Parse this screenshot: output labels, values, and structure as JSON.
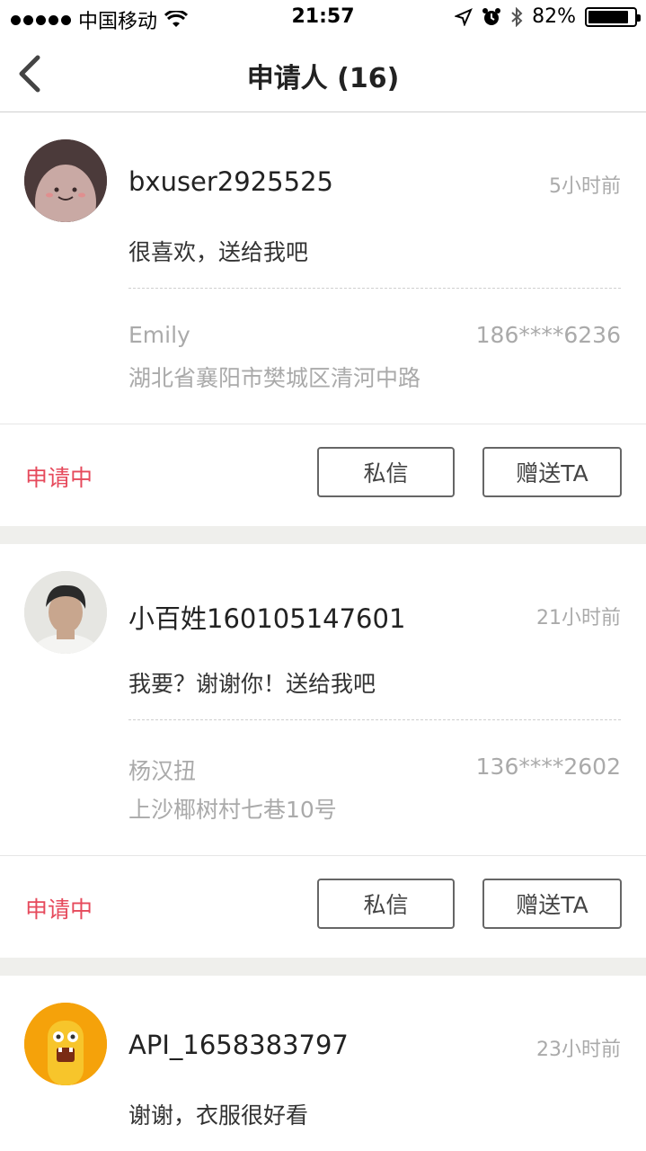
{
  "status_bar": {
    "carrier": "中国移动",
    "time": "21:57",
    "battery": "82%",
    "battery_level": 0.82
  },
  "nav": {
    "title": "申请人 (16)"
  },
  "applicants": [
    {
      "username": "bxuser2925525",
      "time": "5小时前",
      "message": "很喜欢，送给我吧",
      "recipient_name": "Emily",
      "phone": "186****6236",
      "address": "湖北省襄阳市樊城区清河中路",
      "status": "申请中",
      "message_button": "私信",
      "give_button": "赠送TA"
    },
    {
      "username": "小百姓160105147601",
      "time": "21小时前",
      "message": "我要？谢谢你！送给我吧",
      "recipient_name": "杨汉扭",
      "phone": "136****2602",
      "address": "上沙椰树村七巷10号",
      "status": "申请中",
      "message_button": "私信",
      "give_button": "赠送TA"
    },
    {
      "username": "API_1658383797",
      "time": "23小时前",
      "message": "谢谢，衣服很好看"
    }
  ],
  "colors": {
    "status_accent": "#e64a5c",
    "muted_text": "#aaaaaa",
    "section_gap": "#efefec"
  }
}
